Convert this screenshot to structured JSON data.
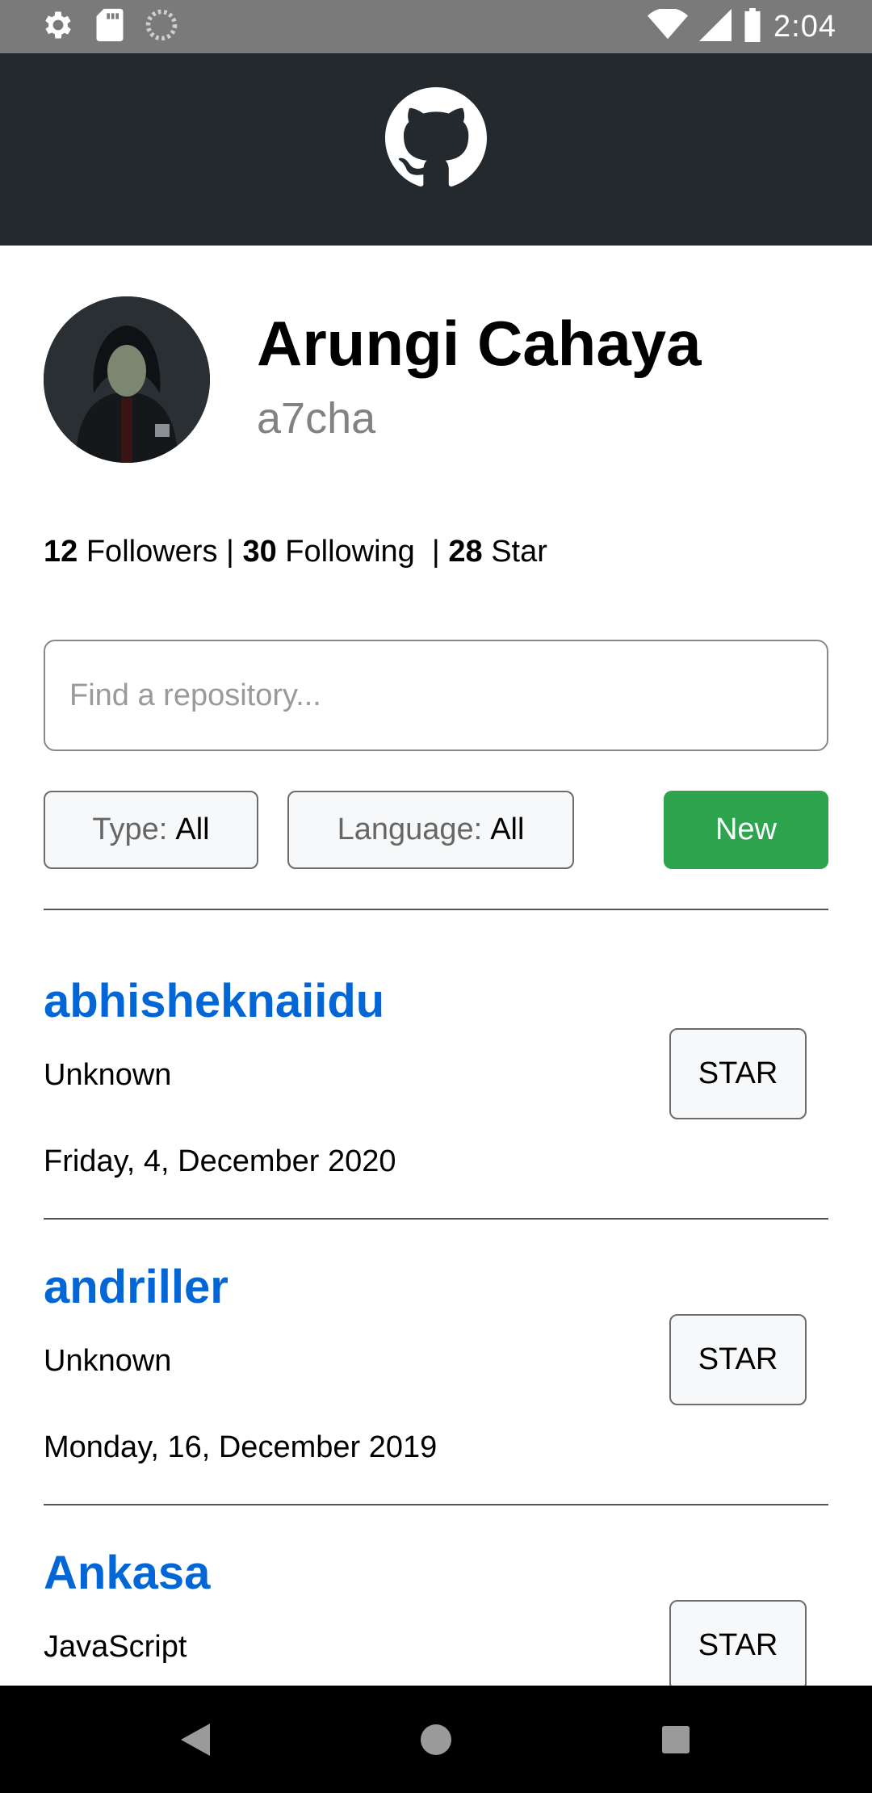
{
  "status_bar": {
    "time": "2:04",
    "left_icons": [
      "settings-icon",
      "sd-card-icon",
      "sync-icon"
    ],
    "right_icons": [
      "wifi-icon",
      "signal-icon",
      "battery-icon"
    ]
  },
  "header": {
    "logo": "github-octocat-icon",
    "background": "#24292e"
  },
  "profile": {
    "full_name": "Arungi Cahaya",
    "username": "a7cha",
    "followers_count": "12",
    "followers_label": "Followers |",
    "following_count": "30",
    "following_label": "Following  |",
    "star_count": "28",
    "star_label": "Star"
  },
  "search": {
    "placeholder": "Find a repository...",
    "value": ""
  },
  "filters": {
    "type_label": "Type:",
    "type_value": "All",
    "language_label": "Language:",
    "language_value": "All",
    "new_label": "New",
    "new_color": "#2ea44f"
  },
  "repositories": [
    {
      "name": "abhisheknaiidu",
      "language": "Unknown",
      "date": "Friday, 4, December 2020",
      "star_label": "STAR"
    },
    {
      "name": "andriller",
      "language": "Unknown",
      "date": "Monday, 16, December 2019",
      "star_label": "STAR"
    },
    {
      "name": "Ankasa",
      "language": "JavaScript",
      "date": "",
      "star_label": "STAR"
    }
  ],
  "link_color": "#0366d6",
  "nav_bar": [
    "back-icon",
    "home-icon",
    "recents-icon"
  ]
}
